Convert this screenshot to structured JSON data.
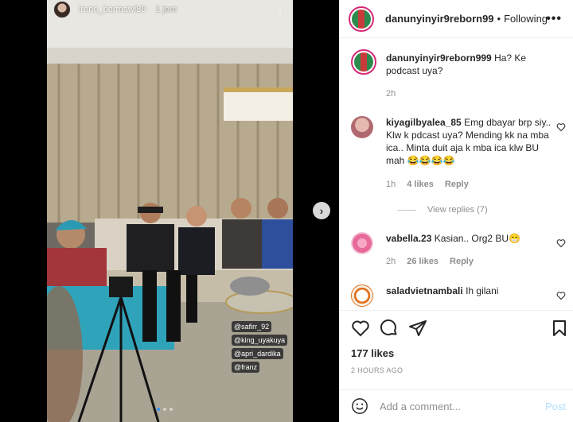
{
  "story": {
    "username": "irene_bermawi89",
    "time": "1 jam",
    "tags": [
      "@safirr_92",
      "@king_uyakuya",
      "@apri_dardika",
      "@franz"
    ]
  },
  "post": {
    "username": "danunyinyir9reborn99",
    "separator": "•",
    "follow_status": "Following",
    "more_label": "•••"
  },
  "comments": [
    {
      "username": "danunyinyir9reborn999",
      "text": "Ha? Ke podcast uya?",
      "time": "2h"
    },
    {
      "username": "kiyagilbyalea_85",
      "text": "Emg dbayar brp siy.. Klw k pdcast uya? Mending kk na mba ica.. Minta duit aja k mba ica klw BU mah 😂😂😂😂",
      "time": "1h",
      "likes": "4 likes",
      "reply": "Reply",
      "view_replies": "View replies (7)"
    },
    {
      "username": "vabella.23",
      "text": "Kasian.. Org2 BU😁",
      "time": "2h",
      "likes": "26 likes",
      "reply": "Reply"
    },
    {
      "username": "saladvietnambali",
      "text": "Ih gilani"
    }
  ],
  "stats": {
    "likes": "177 likes",
    "ago": "2 HOURS AGO"
  },
  "add_comment": {
    "placeholder": "Add a comment...",
    "post_label": "Post"
  },
  "icons": {
    "next": "chevron-right-icon",
    "like": "heart-icon",
    "comment": "comment-icon",
    "share": "paper-plane-icon",
    "save": "bookmark-icon",
    "emoji": "emoji-icon"
  },
  "colors": {
    "link_blue": "#3897f0",
    "post_disabled": "#b2dffc",
    "story_ring": "#d62976"
  }
}
